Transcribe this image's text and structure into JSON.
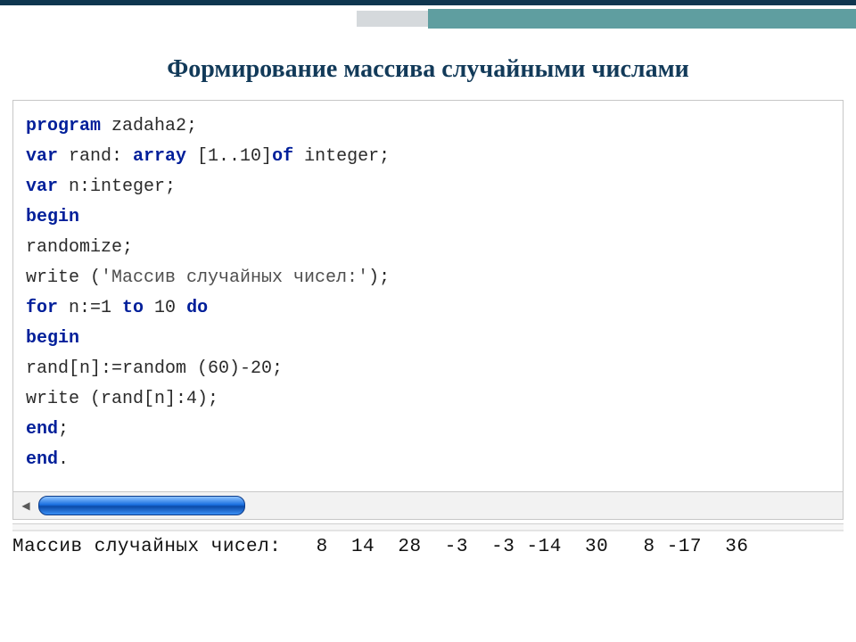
{
  "title": "Формирование массива случайными числами",
  "code": {
    "l1_kw": "program",
    "l1_rest": " zadaha2;",
    "l2_kw1": "var",
    "l2_mid": " rand: ",
    "l2_kw2": "array",
    "l2_mid2": " [1..10]",
    "l2_kw3": "of",
    "l2_rest": " integer;",
    "l3_kw": "var",
    "l3_rest": " n:integer;",
    "l4_kw": "begin",
    "l5": "randomize;",
    "l6a": "write (",
    "l6_str": "'Массив случайных чисел:'",
    "l6b": ");",
    "l7_kw1": "for",
    "l7_mid1": " n:=1 ",
    "l7_kw2": "to",
    "l7_mid2": " 10 ",
    "l7_kw3": "do",
    "l8_kw": "begin",
    "l9": "rand[n]:=random (60)-20;",
    "l10": "write (rand[n]:4);",
    "l11_kw": "end",
    "l11_rest": ";",
    "l12_kw": "end",
    "l12_rest": "."
  },
  "scroll": {
    "left_arrow": "◀",
    "right_arrow": ""
  },
  "output_line": "Массив случайных чисел:   8  14  28  -3  -3 -14  30   8 -17  36"
}
